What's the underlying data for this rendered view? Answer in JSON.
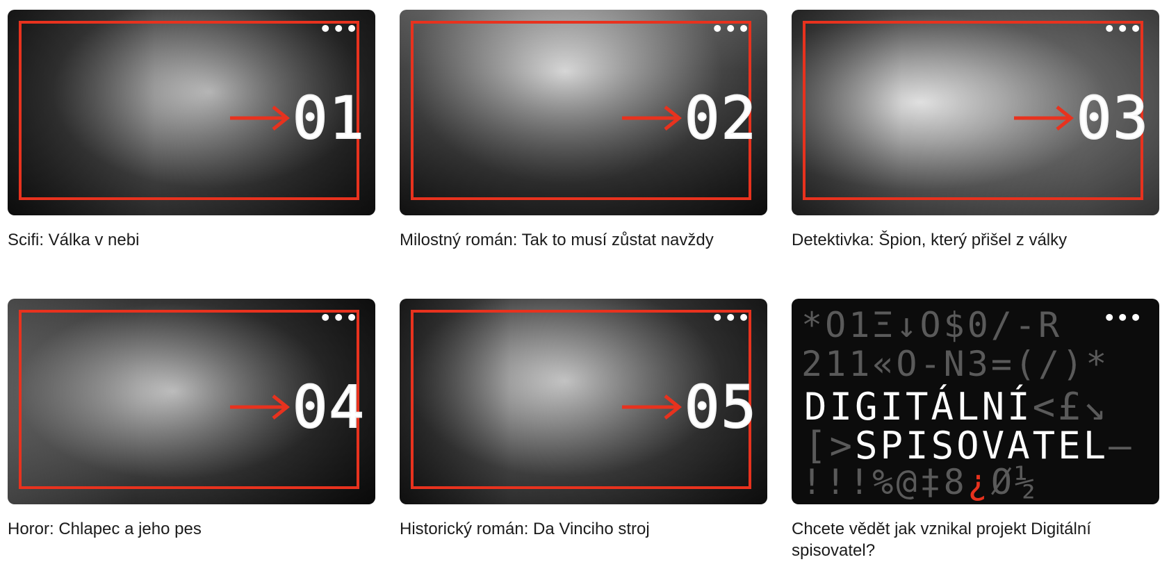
{
  "colors": {
    "accent": "#e8321e",
    "text": "#1b1b1b",
    "background": "#ffffff"
  },
  "icons": {
    "more": "more-horizontal-icon",
    "arrow": "arrow-right-icon"
  },
  "cards": [
    {
      "number": "01",
      "more_label": "•••",
      "title": "Scifi: Válka v nebi"
    },
    {
      "number": "02",
      "more_label": "•••",
      "title": "Milostný román: Tak to musí zůstat navždy"
    },
    {
      "number": "03",
      "more_label": "•••",
      "title": "Detektivka: Špion, který přišel z války"
    },
    {
      "number": "04",
      "more_label": "•••",
      "title": "Horor: Chlapec a jeho pes"
    },
    {
      "number": "05",
      "more_label": "•••",
      "title": "Historický román: Da Vinciho stroj"
    },
    {
      "more_label": "•••",
      "title": "Chcete vědět jak vznikal projekt Digitální spisovatel?",
      "cover": {
        "glyph_line_1": "*O1Ξ↓O$0/-R",
        "glyph_line_2": "211«O-N3=(/)*",
        "word_1": "DIGITÁLNÍ",
        "word_1_tail": "<£↘",
        "word_2_head": "[>",
        "word_2": "SPISOVATEL",
        "word_2_tail": "—",
        "glyph_line_3_a": "!!!%@‡8",
        "glyph_line_3_accent": "¿",
        "glyph_line_3_b": "Ø½"
      }
    }
  ]
}
